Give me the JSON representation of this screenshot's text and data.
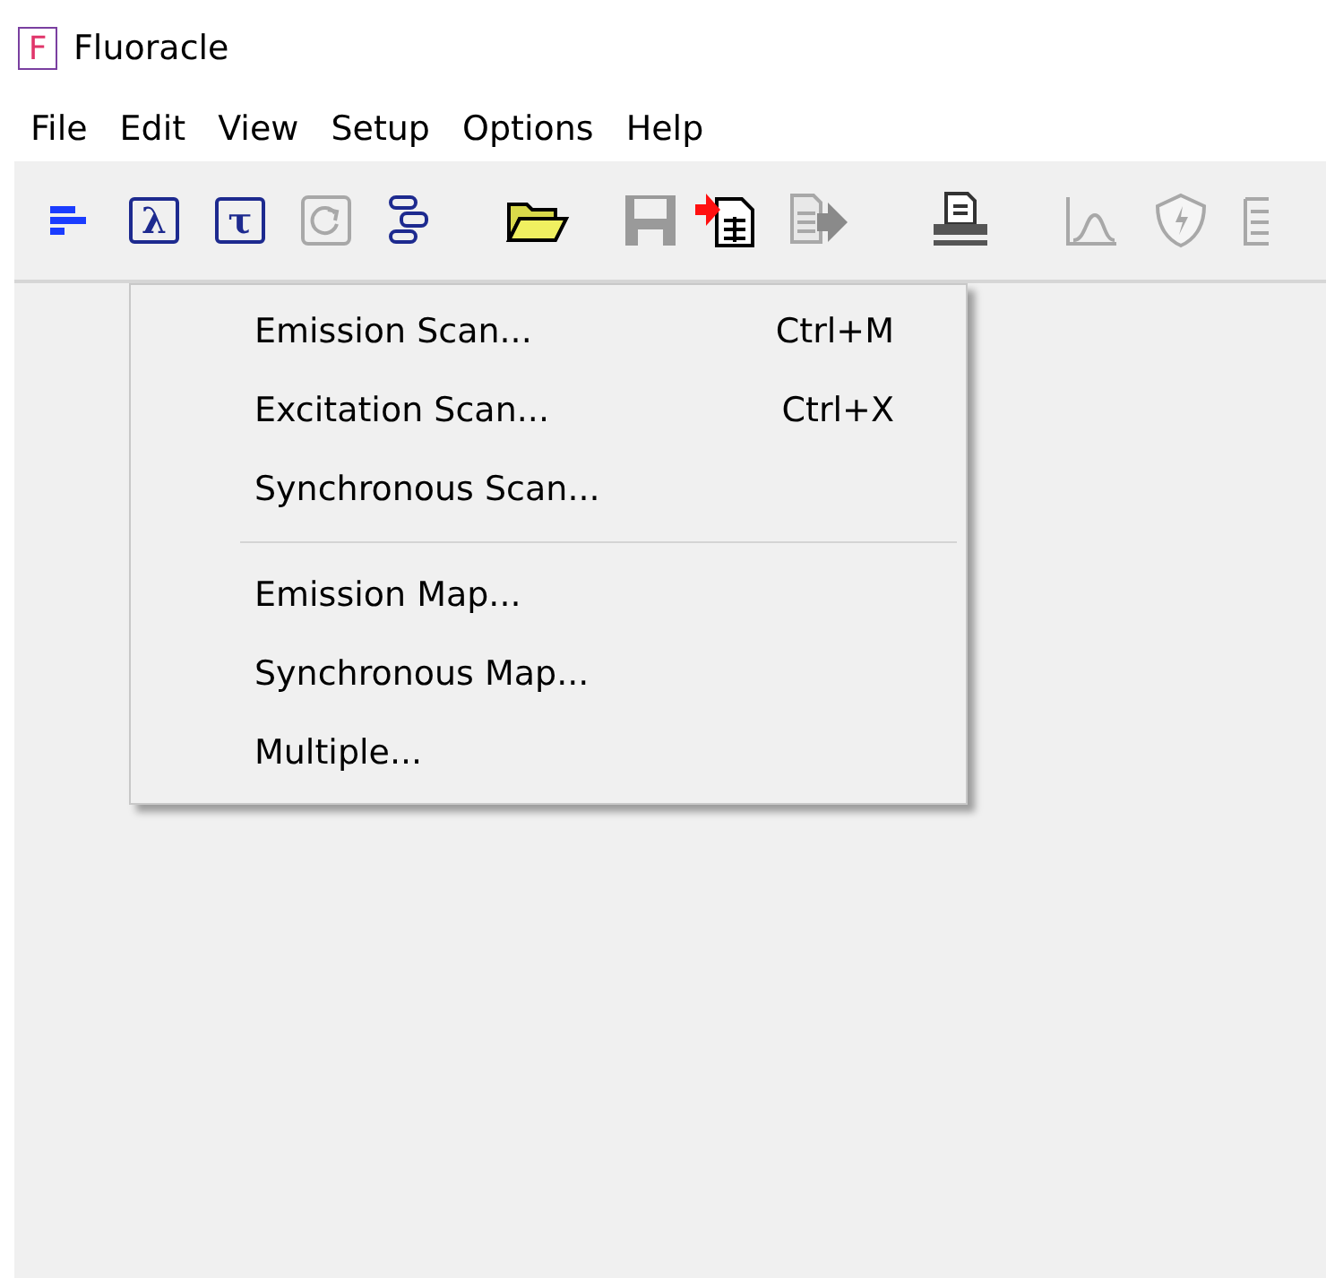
{
  "window": {
    "icon_letter": "F",
    "title": "Fluoracle"
  },
  "menu_bar": [
    {
      "label": "File",
      "selected": false
    },
    {
      "label": "Edit",
      "selected": false
    },
    {
      "label": "View",
      "selected": false
    },
    {
      "label": "Setup",
      "selected": false
    },
    {
      "label": "Options",
      "selected": false
    },
    {
      "label": "Help",
      "selected": false
    }
  ],
  "toolbar": [
    {
      "kind": "bars",
      "disabled": false
    },
    {
      "kind": "glyph",
      "glyph": "λ",
      "disabled": false
    },
    {
      "kind": "glyph",
      "glyph": "τ",
      "disabled": false
    },
    {
      "kind": "refresh",
      "disabled": true
    },
    {
      "kind": "brackets",
      "disabled": false
    },
    {
      "kind": "folder",
      "disabled": false
    },
    {
      "kind": "save",
      "disabled": true
    },
    {
      "kind": "import",
      "disabled": false
    },
    {
      "kind": "export",
      "disabled": true
    },
    {
      "kind": "print",
      "disabled": false
    },
    {
      "kind": "curve",
      "disabled": true
    },
    {
      "kind": "shield",
      "disabled": true
    },
    {
      "kind": "table",
      "disabled": true
    }
  ],
  "dropdown_menu": {
    "groups": [
      [
        {
          "label": "Emission Scan...",
          "shortcut": "Ctrl+M"
        },
        {
          "label": "Excitation Scan...",
          "shortcut": "Ctrl+X"
        },
        {
          "label": "Synchronous Scan..."
        }
      ],
      [
        {
          "label": "Emission Map..."
        },
        {
          "label": "Synchronous Map..."
        },
        {
          "label": "Multiple..."
        }
      ]
    ]
  }
}
